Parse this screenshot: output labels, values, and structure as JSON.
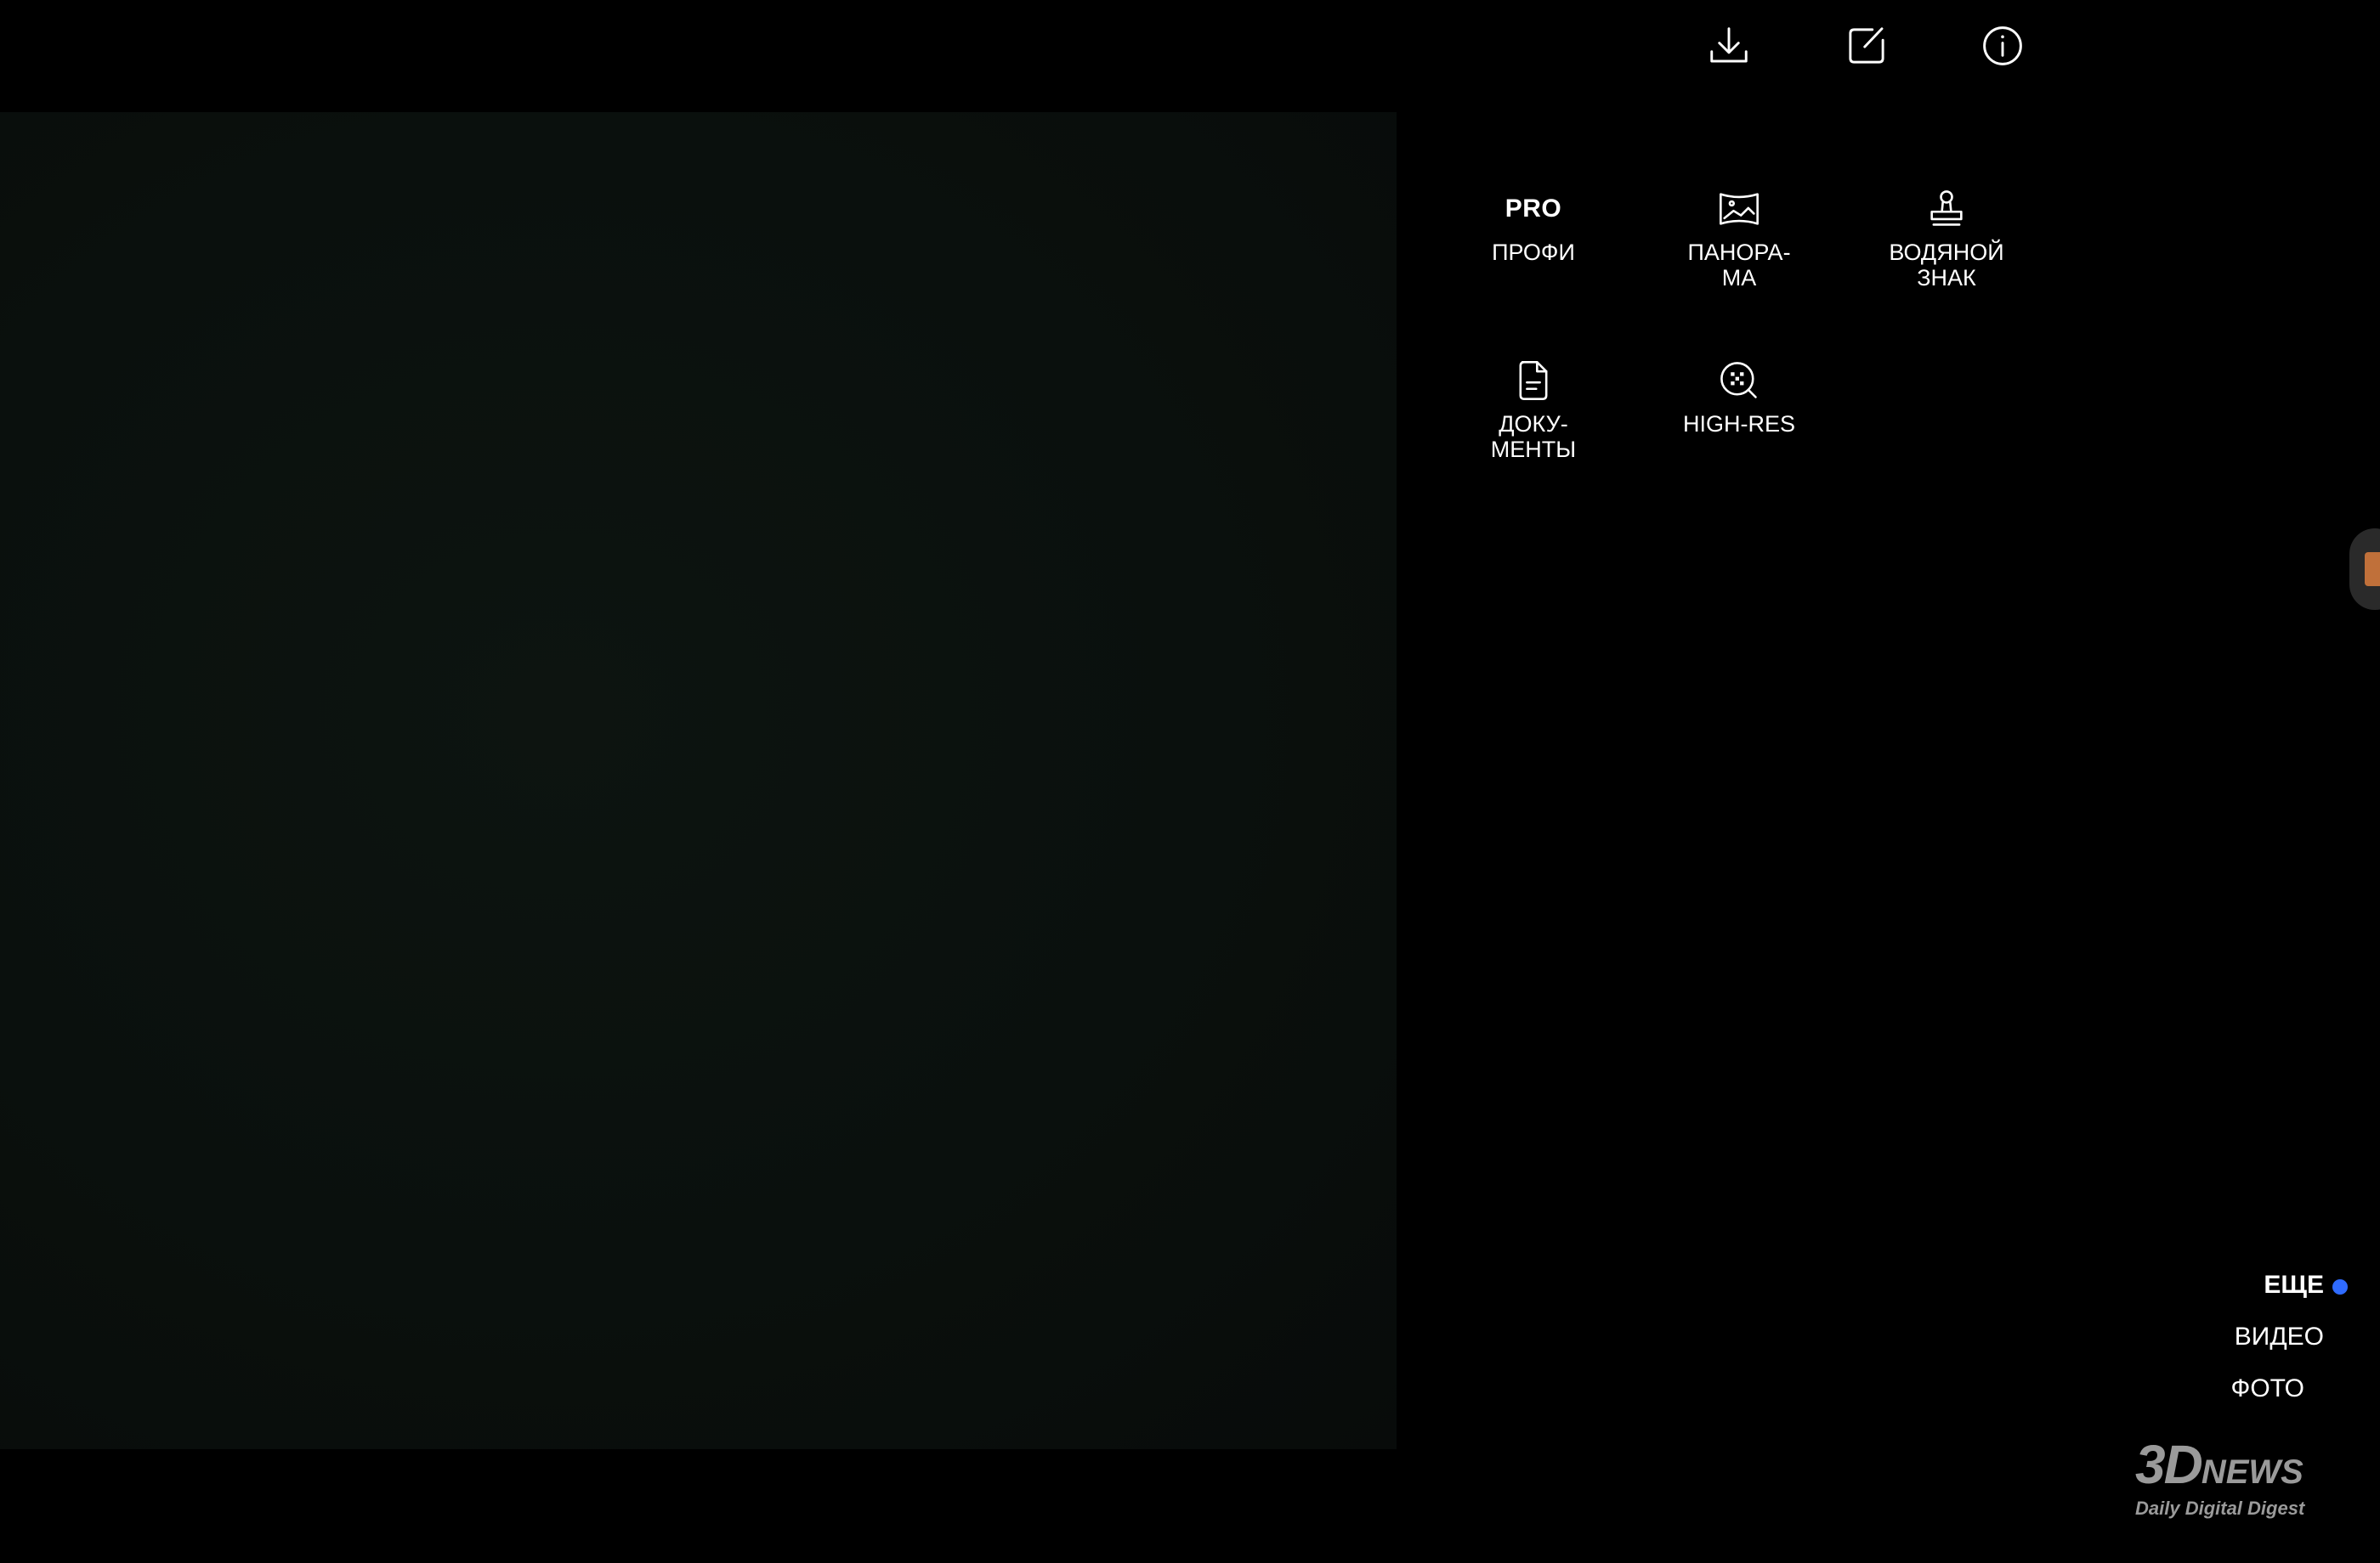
{
  "top_bar": {
    "icons": [
      "download-icon",
      "edit-icon",
      "info-icon"
    ]
  },
  "modes": [
    {
      "icon": "pro-text-icon",
      "icon_text": "PRO",
      "label": "ПРОФИ"
    },
    {
      "icon": "panorama-icon",
      "label": "ПАНОРА-\nМА"
    },
    {
      "icon": "stamp-icon",
      "label": "ВОДЯНОЙ\nЗНАК"
    },
    {
      "icon": "document-icon",
      "label": "ДОКУ-\nМЕНТЫ"
    },
    {
      "icon": "high-res-icon",
      "label": "HIGH-RES"
    }
  ],
  "mode_switcher": {
    "more": "ЕЩЕ",
    "video": "ВИДЕО",
    "photo": "ФОТО",
    "active": "more",
    "active_color": "#2f6bff"
  },
  "watermark": {
    "logo_3d": "3D",
    "logo_news": "NEWS",
    "tagline": "Daily Digital Digest"
  }
}
